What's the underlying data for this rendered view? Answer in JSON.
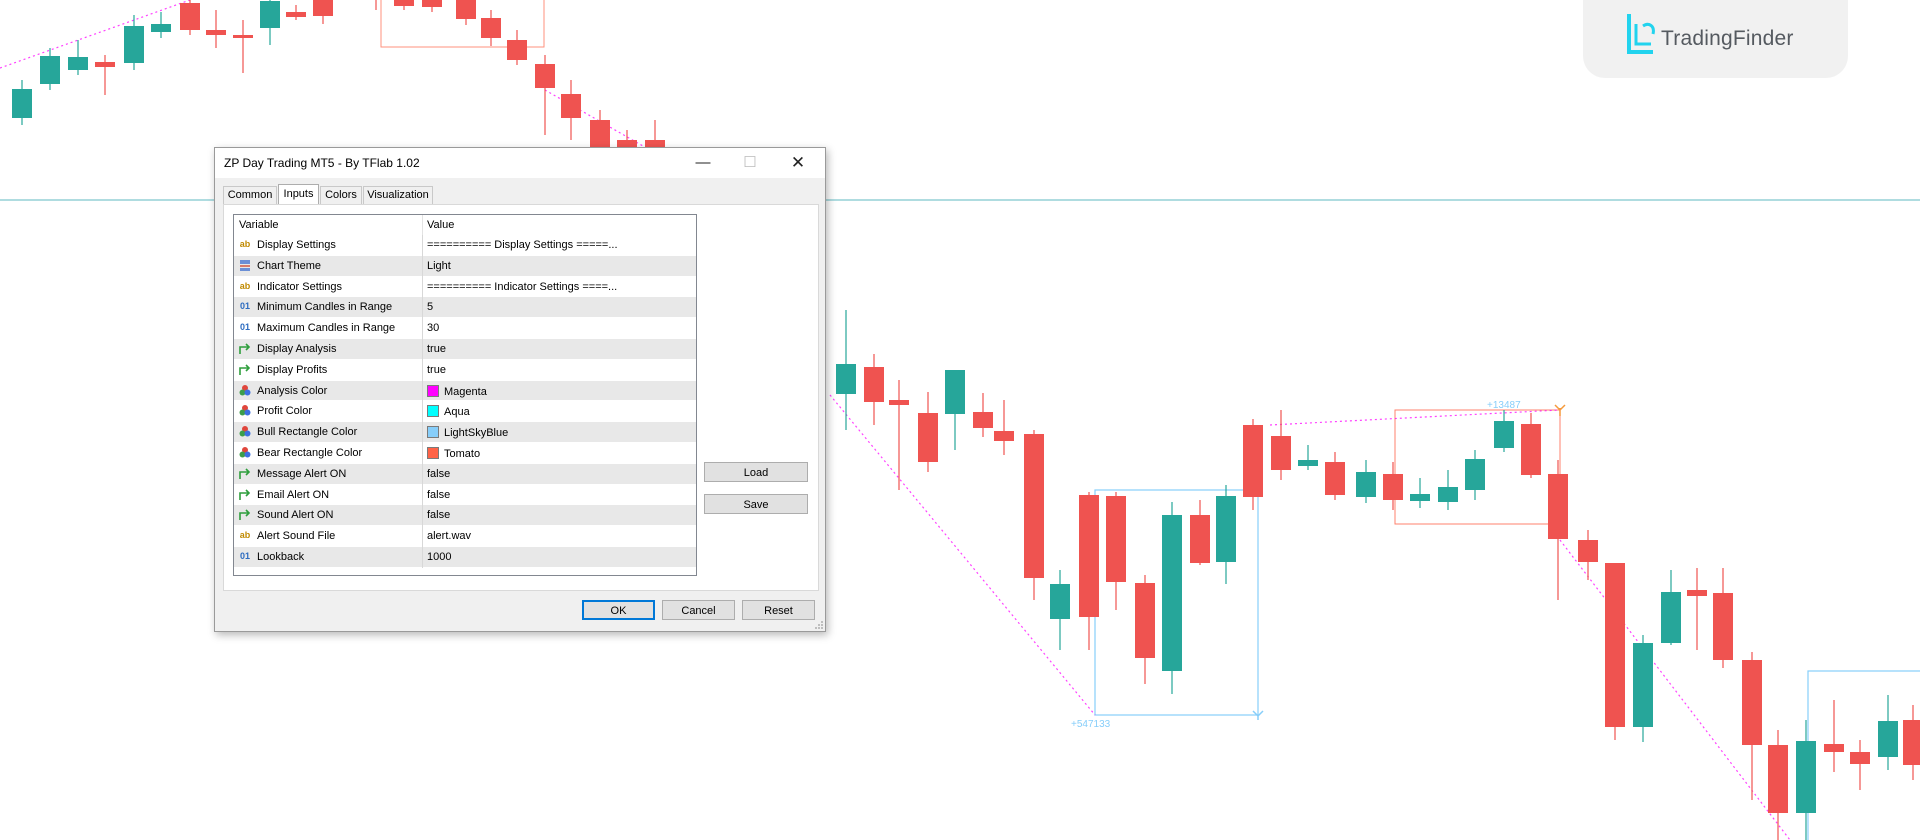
{
  "dialog": {
    "title": "ZP Day Trading MT5 - By TFlab 1.02",
    "window_buttons": {
      "minimize": "—",
      "maximize": "☐",
      "close": "✕"
    },
    "tabs": [
      {
        "label": "Common",
        "active": false
      },
      {
        "label": "Inputs",
        "active": true
      },
      {
        "label": "Colors",
        "active": false
      },
      {
        "label": "Visualization",
        "active": false
      }
    ],
    "columns": {
      "variable": "Variable",
      "value": "Value"
    },
    "rows": [
      {
        "icon": "ab",
        "name": "Display Settings",
        "value": "========== Display Settings =====..."
      },
      {
        "icon": "enum",
        "name": "Chart Theme",
        "value": "Light"
      },
      {
        "icon": "ab",
        "name": "Indicator Settings",
        "value": "========== Indicator Settings ====..."
      },
      {
        "icon": "01",
        "name": "Minimum Candles in Range",
        "value": "5"
      },
      {
        "icon": "01",
        "name": "Maximum Candles in Range",
        "value": "30"
      },
      {
        "icon": "bool",
        "name": "Display Analysis",
        "value": "true"
      },
      {
        "icon": "bool",
        "name": "Display Profits",
        "value": "true"
      },
      {
        "icon": "color",
        "name": "Analysis Color",
        "value": "Magenta",
        "swatch": "#ff00ff"
      },
      {
        "icon": "color",
        "name": "Profit Color",
        "value": "Aqua",
        "swatch": "#00ffff"
      },
      {
        "icon": "color",
        "name": "Bull Rectangle Color",
        "value": "LightSkyBlue",
        "swatch": "#87cefa"
      },
      {
        "icon": "color",
        "name": "Bear Rectangle Color",
        "value": "Tomato",
        "swatch": "#ff6347"
      },
      {
        "icon": "bool",
        "name": "Message Alert ON",
        "value": "false"
      },
      {
        "icon": "bool",
        "name": "Email Alert ON",
        "value": "false"
      },
      {
        "icon": "bool",
        "name": "Sound Alert ON",
        "value": "false"
      },
      {
        "icon": "ab",
        "name": "Alert Sound File",
        "value": "alert.wav"
      },
      {
        "icon": "01",
        "name": "Lookback",
        "value": "1000"
      }
    ],
    "buttons": {
      "load": "Load",
      "save": "Save",
      "ok": "OK",
      "cancel": "Cancel",
      "reset": "Reset"
    }
  },
  "brand": {
    "name": "TradingFinder"
  },
  "chart": {
    "annotations": {
      "bull_profit": "+547133",
      "bear_profit": "+13487"
    },
    "colors": {
      "bull": "#26a69a",
      "bear": "#ef5350",
      "analysis_line": "#ff00ff",
      "bull_rect": "#87cefa",
      "bear_rect": "#ff6347",
      "level_line": "#5fb9c2"
    }
  }
}
